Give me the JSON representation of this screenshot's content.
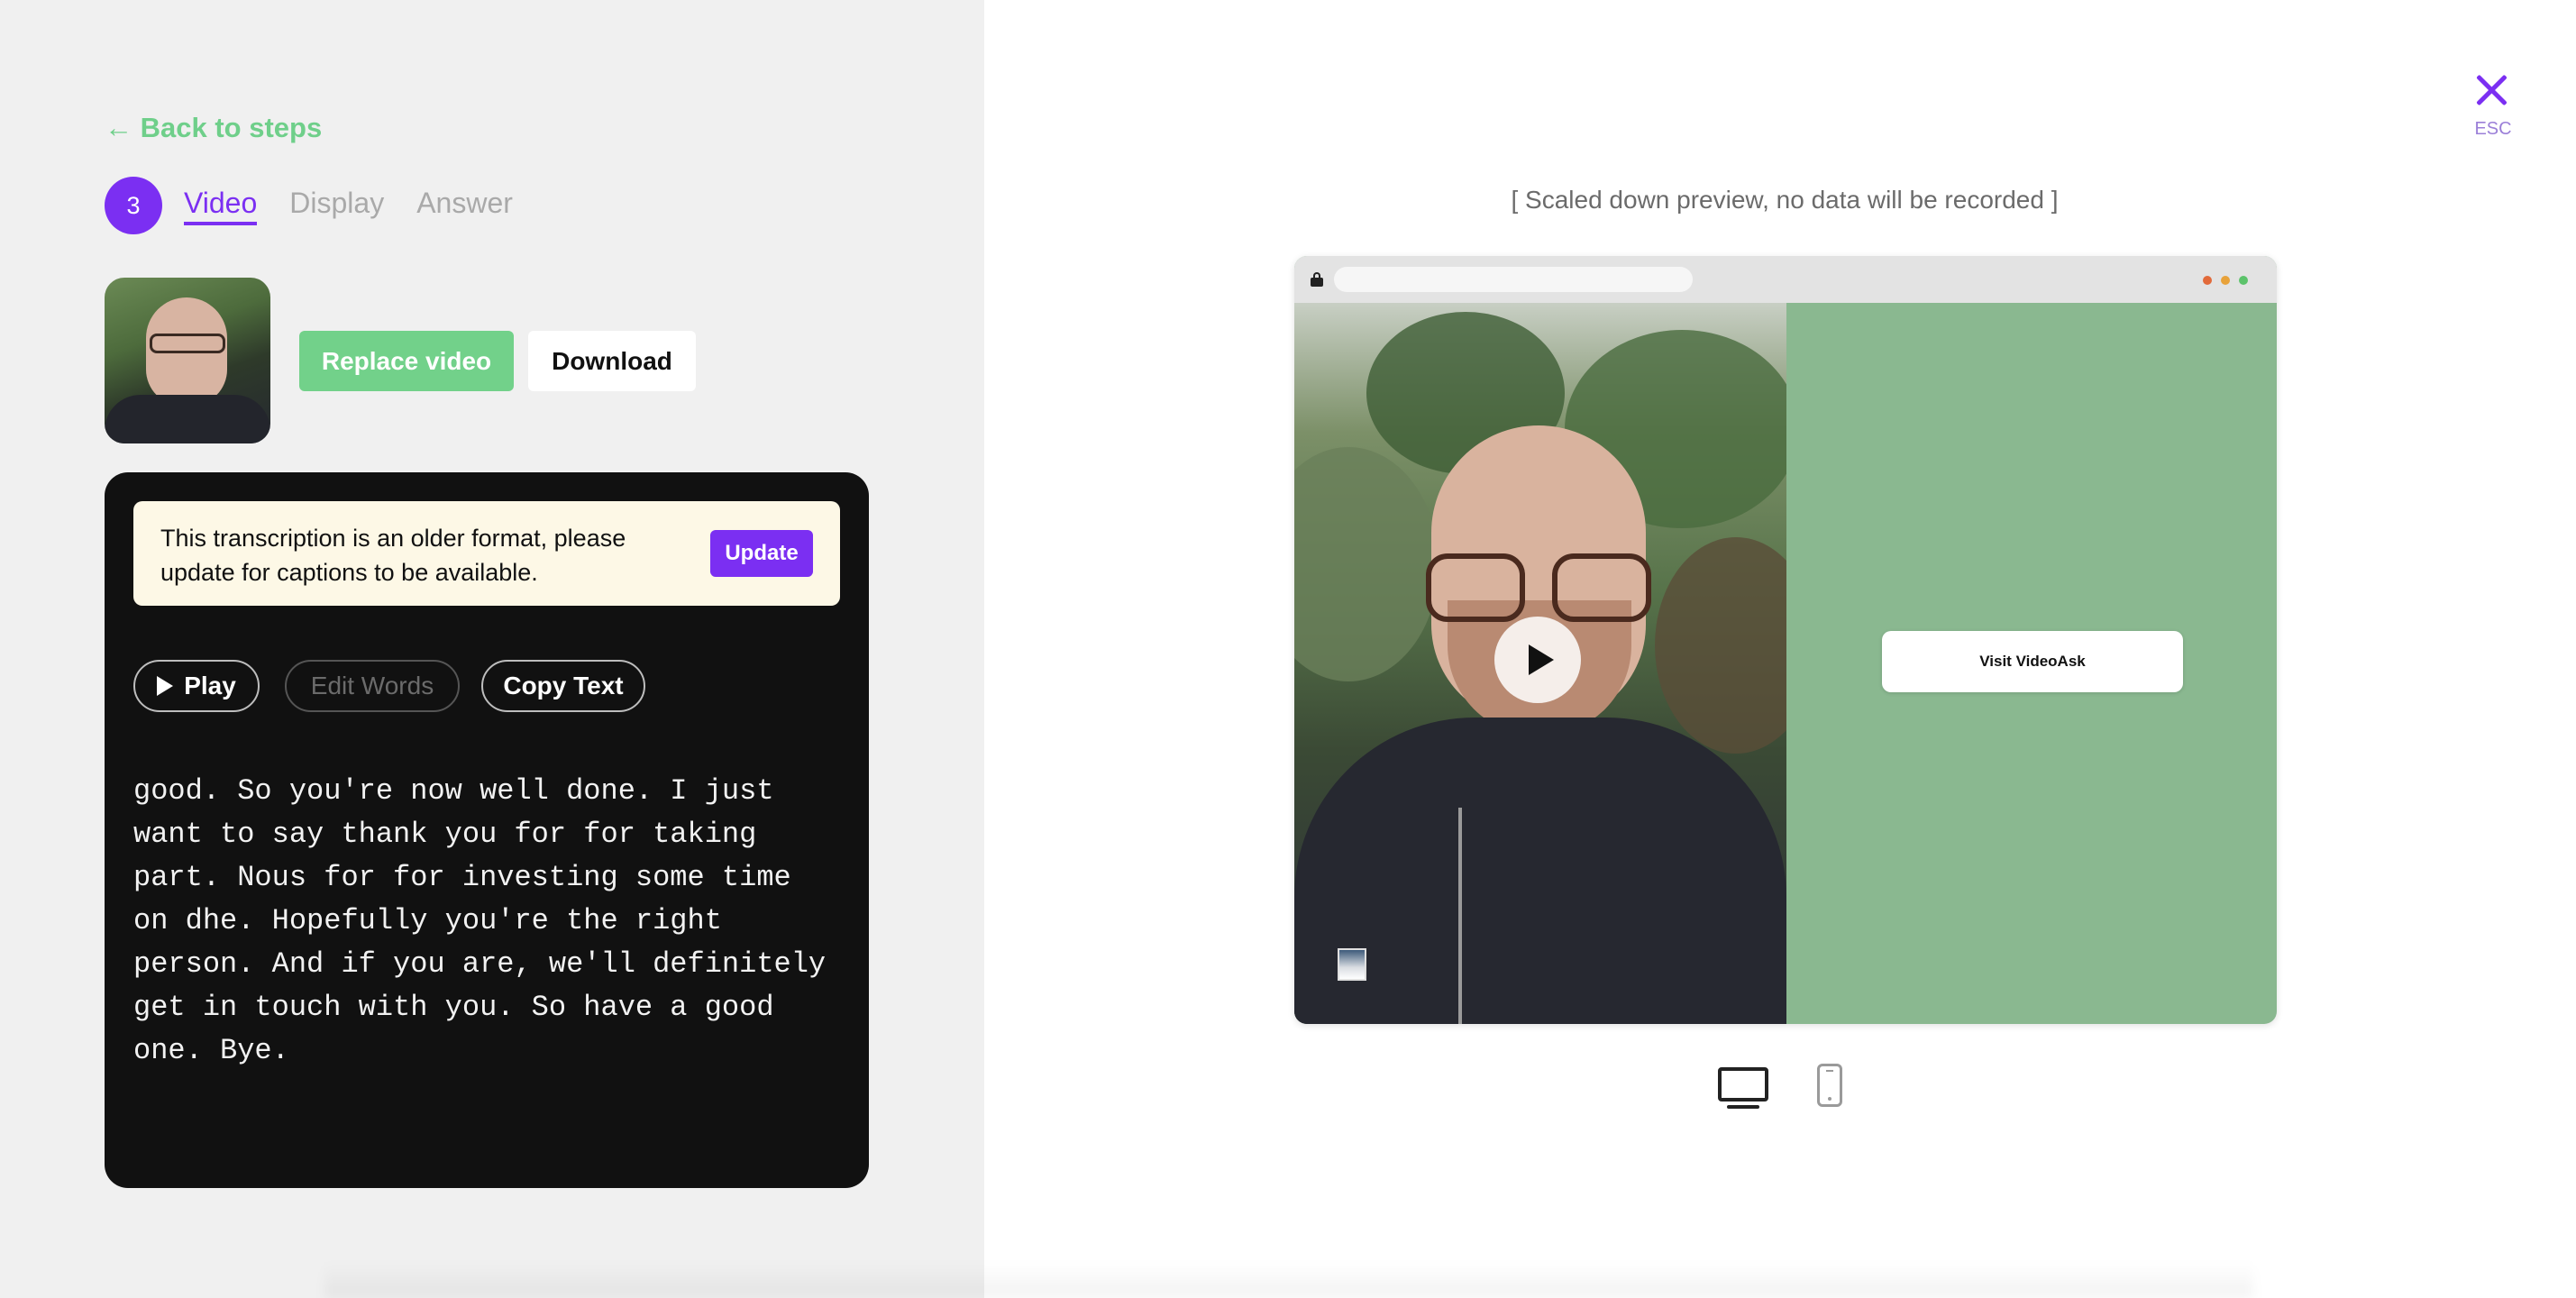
{
  "nav": {
    "back_label": "← Back to steps"
  },
  "steps": {
    "current_number": "3",
    "tabs": [
      {
        "label": "Video",
        "active": true
      },
      {
        "label": "Display",
        "active": false
      },
      {
        "label": "Answer",
        "active": false
      }
    ]
  },
  "media": {
    "replace_label": "Replace video",
    "download_label": "Download"
  },
  "transcript": {
    "notice_text": "This transcription is an older format, please update for captions to be available.",
    "update_label": "Update",
    "play_label": "Play",
    "edit_words_label": "Edit Words",
    "copy_text_label": "Copy Text",
    "text": "good. So you're now well done. I just\nwant to say thank you for for taking\npart. Nous for for investing some time\non dhe. Hopefully you're the right\nperson. And if you are, we'll definitely\nget in touch with you. So have a good\none. Bye."
  },
  "preview": {
    "close_label": "ESC",
    "caption": "[ Scaled down preview, no data will be recorded ]",
    "visit_button_label": "Visit VideoAsk"
  },
  "colors": {
    "accent": "#7b2ff2",
    "success": "#72d18a",
    "preview_background": "#8ab890",
    "notice_background": "#fdf8e6"
  },
  "icons": [
    "arrow-left-icon",
    "play-icon",
    "close-icon",
    "lock-icon",
    "desktop-icon",
    "mobile-icon"
  ]
}
